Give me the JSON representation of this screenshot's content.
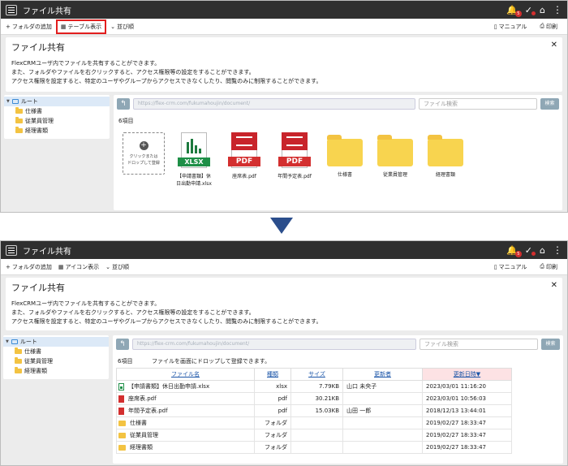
{
  "app": {
    "title": "ファイル共有",
    "notification_count": "5"
  },
  "icons": {
    "menu": "hamburger-icon",
    "bell": "bell-icon",
    "check": "check-icon",
    "home": "home-icon",
    "more": "kebab-icon",
    "arrow": "down-arrow-icon"
  },
  "colors": {
    "titlebar": "#2f2f2f",
    "highlight": "#e21e1e",
    "arrow": "#2b4e8c",
    "sorted_header": "#fde2e4"
  },
  "toolbar_top": {
    "add_folder": "フォルダの追加",
    "view_toggle": "テーブル表示",
    "sort": "並び順",
    "manual": "マニュアル",
    "print": "印刷"
  },
  "toolbar_bottom": {
    "add_folder": "フォルダの追加",
    "view_toggle": "アイコン表示",
    "sort": "並び順",
    "manual": "マニュアル",
    "print": "印刷"
  },
  "info": {
    "title": "ファイル共有",
    "line1": "FlexCRMユーザ内でファイルを共有することができます。",
    "line2": "また、フォルダやファイルを右クリックすると、アクセス権限等の設定をすることができます。",
    "line3": "アクセス権限を設定すると、特定のユーザやグループからアクセスできなくしたり、閲覧のみに制限することができます。"
  },
  "tree": {
    "root": "ルート",
    "items": [
      "仕様書",
      "従業員管理",
      "経理書類"
    ]
  },
  "main": {
    "path": "https://flex-crm.com/fukumahoujin/document/",
    "search_placeholder": "ファイル検索",
    "search_button": "検索",
    "count": "6項目",
    "drop_hint": "ファイルを画面にドロップして登録できます。",
    "drop_box_line1": "クリックまたは",
    "drop_box_line2": "ドロップして登録"
  },
  "tiles": [
    {
      "type": "xlsx",
      "badge": "XLSX",
      "label1": "【申請書類】休",
      "label2": "日出勤申請.xlsx"
    },
    {
      "type": "pdf",
      "badge": "PDF",
      "label1": "座席表.pdf",
      "label2": ""
    },
    {
      "type": "pdf",
      "badge": "PDF",
      "label1": "年間予定表.pdf",
      "label2": ""
    },
    {
      "type": "folder",
      "label1": "仕様書",
      "label2": ""
    },
    {
      "type": "folder",
      "label1": "従業員管理",
      "label2": ""
    },
    {
      "type": "folder",
      "label1": "経理書類",
      "label2": ""
    }
  ],
  "table": {
    "headers": {
      "name": "ファイル名",
      "kind": "種類",
      "size": "サイズ",
      "updater": "更新者",
      "updated": "更新日時▼"
    },
    "rows": [
      {
        "icon": "xlsx",
        "name": "【申請書類】休日出勤申請.xlsx",
        "kind": "xlsx",
        "size": "7.79KB",
        "updater": "山口 未央子",
        "updated": "2023/03/01 11:16:20"
      },
      {
        "icon": "pdf",
        "name": "座席表.pdf",
        "kind": "pdf",
        "size": "30.21KB",
        "updater": "",
        "updated": "2023/03/01 10:56:03"
      },
      {
        "icon": "pdf",
        "name": "年間予定表.pdf",
        "kind": "pdf",
        "size": "15.03KB",
        "updater": "山田 一郎",
        "updated": "2018/12/13 13:44:01"
      },
      {
        "icon": "folder",
        "name": "仕様書",
        "kind": "フォルダ",
        "size": "",
        "updater": "",
        "updated": "2019/02/27 18:33:47"
      },
      {
        "icon": "folder",
        "name": "従業員管理",
        "kind": "フォルダ",
        "size": "",
        "updater": "",
        "updated": "2019/02/27 18:33:47"
      },
      {
        "icon": "folder",
        "name": "経理書類",
        "kind": "フォルダ",
        "size": "",
        "updater": "",
        "updated": "2019/02/27 18:33:47"
      }
    ]
  }
}
